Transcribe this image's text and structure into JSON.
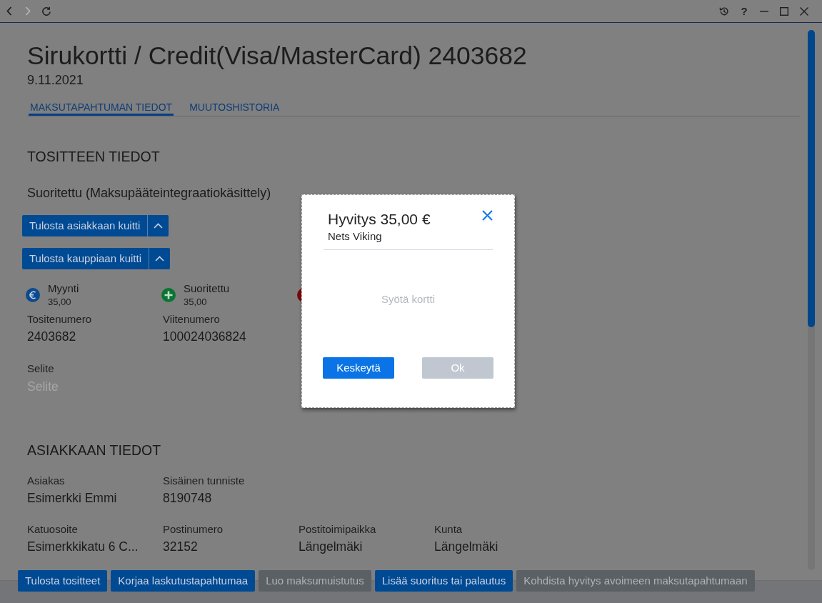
{
  "toolbar": {
    "nav_buttons": [
      {
        "kind": "back",
        "disabled": false
      },
      {
        "kind": "forward",
        "disabled": true
      },
      {
        "kind": "reload",
        "disabled": false
      }
    ],
    "window_buttons": [
      {
        "kind": "history"
      },
      {
        "kind": "help",
        "label": "?"
      },
      {
        "kind": "minimize"
      },
      {
        "kind": "maximize"
      },
      {
        "kind": "close"
      }
    ]
  },
  "header": {
    "title": "Sirukortti / Credit(Visa/MasterCard) 2403682",
    "date": "9.11.2021"
  },
  "tabs": [
    {
      "label": "MAKSUTAPAHTUMAN TIEDOT",
      "selected": true
    },
    {
      "label": "MUUTOSHISTORIA",
      "selected": false
    }
  ],
  "voucher": {
    "heading": "TOSITTEEN TIEDOT",
    "status": "Suoritettu (Maksupääteintegraatiokäsittely)",
    "print_buttons": [
      {
        "label": "Tulosta asiakkaan kuitti"
      },
      {
        "label": "Tulosta kauppiaan kuitti"
      }
    ],
    "events": [
      {
        "kind": "euro",
        "color": "#0c4a8e",
        "label": "Myynti",
        "amount": "35,00"
      },
      {
        "kind": "plus",
        "color": "#0a7433",
        "label": "Suoritettu",
        "amount": "35,00"
      },
      {
        "kind": "dot",
        "color": "#7d0707"
      }
    ],
    "fields": [
      {
        "label": "Tositenumero",
        "value": "2403682"
      },
      {
        "label": "Viitenumero",
        "value": "100024036824"
      }
    ],
    "description": {
      "label": "Selite",
      "placeholder": "Selite"
    }
  },
  "customer": {
    "heading": "ASIAKKAAN TIEDOT",
    "rows": [
      [
        {
          "label": "Asiakas",
          "value": "Esimerkki Emmi"
        },
        {
          "label": "Sisäinen tunniste",
          "value": "8190748"
        }
      ],
      [
        {
          "label": "Katuosoite",
          "value": "Esimerkkikatu 6 C..."
        },
        {
          "label": "Postinumero",
          "value": "32152"
        },
        {
          "label": "Postitoimipaikka",
          "value": "Längelmäki"
        },
        {
          "label": "Kunta",
          "value": "Längelmäki"
        }
      ]
    ]
  },
  "actions": [
    {
      "label": "Tulosta tositteet",
      "disabled": false
    },
    {
      "label": "Korjaa laskutustapahtumaa",
      "disabled": false
    },
    {
      "label": "Luo maksumuistutus",
      "disabled": true
    },
    {
      "label": "Lisää suoritus tai palautus",
      "disabled": false
    },
    {
      "label": "Kohdista hyvitys avoimeen maksutapahtumaan",
      "disabled": true
    }
  ],
  "dialog": {
    "title": "Hyvitys 35,00 €",
    "subtitle": "Nets Viking",
    "message": "Syötä kortti",
    "buttons": [
      {
        "label": "Keskeytä",
        "disabled": false
      },
      {
        "label": "Ok",
        "disabled": true
      }
    ]
  }
}
